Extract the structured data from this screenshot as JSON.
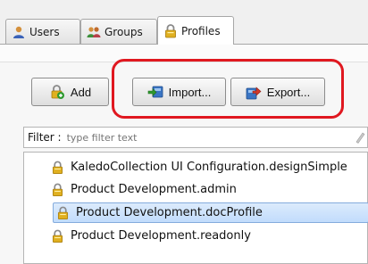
{
  "tabs": [
    {
      "label": "Users",
      "icon": "users-icon"
    },
    {
      "label": "Groups",
      "icon": "groups-icon"
    },
    {
      "label": "Profiles",
      "icon": "lock-icon",
      "active": true
    }
  ],
  "toolbar": {
    "add_label": "Add",
    "import_label": "Import...",
    "export_label": "Export..."
  },
  "filter": {
    "label": "Filter :",
    "placeholder": "type filter text",
    "value": ""
  },
  "profiles": [
    {
      "label": "KaledoCollection UI Configuration.designSimple"
    },
    {
      "label": "Product Development.admin"
    },
    {
      "label": "Product Development.docProfile",
      "selected": true
    },
    {
      "label": "Product Development.readonly"
    }
  ],
  "colors": {
    "highlight": "#e01820",
    "selection": "#c1dcfc",
    "lock": "#e0b020"
  }
}
